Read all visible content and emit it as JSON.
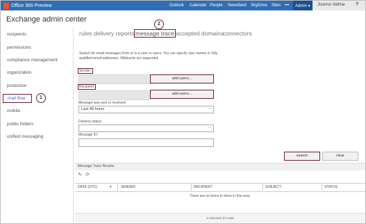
{
  "topbar": {
    "product": "Office 365 Preview",
    "nav": [
      "Outlook",
      "Calendar",
      "People",
      "Newsfeed",
      "SkyDrive",
      "Sites",
      "•••",
      "Admin ▾"
    ],
    "user_name": "Joanna Vathis",
    "user_caret": "▾",
    "help": "?"
  },
  "app_title": "Exchange admin center",
  "sidebar": {
    "items": [
      "recipients",
      "permissions",
      "compliance management",
      "organization",
      "protection",
      "mail flow",
      "mobile",
      "public folders",
      "unified messaging"
    ],
    "selected_index": 5
  },
  "callouts": [
    "1",
    "2"
  ],
  "tabs": [
    "rules",
    "delivery reports",
    "message trace",
    "accepted domains",
    "connectors"
  ],
  "active_tab": "message trace",
  "form": {
    "description": "Search for email messages from or to a user or users. You can specify user names or fully qualified email addresses. Wildcards are supported.",
    "sender_label": "Sender:",
    "recipient_label": "Recipient:",
    "add_users_label": "add users...",
    "sent_label": "Message was sent or received:",
    "sent_value": "Last 48 hours",
    "delivery_label": "Delivery status:",
    "delivery_value": "",
    "message_id_label": "Message ID:",
    "search_label": "search",
    "clear_label": "clear"
  },
  "results": {
    "title": "Message Trace Results",
    "edit_icon": "✎",
    "refresh_icon": "⟳",
    "columns": [
      "DATE (UTC)",
      "SENDER",
      "RECIPIENT",
      "SUBJECT",
      "STATUS"
    ],
    "sort_indicator": "▾",
    "empty_message": "There are no items to show in this view.",
    "footer": "0 selected of 0 total"
  },
  "colors": {
    "topbar": "#2f6db5",
    "highlight_border": "#6d1b2f",
    "accent_text": "#2f6db5"
  }
}
